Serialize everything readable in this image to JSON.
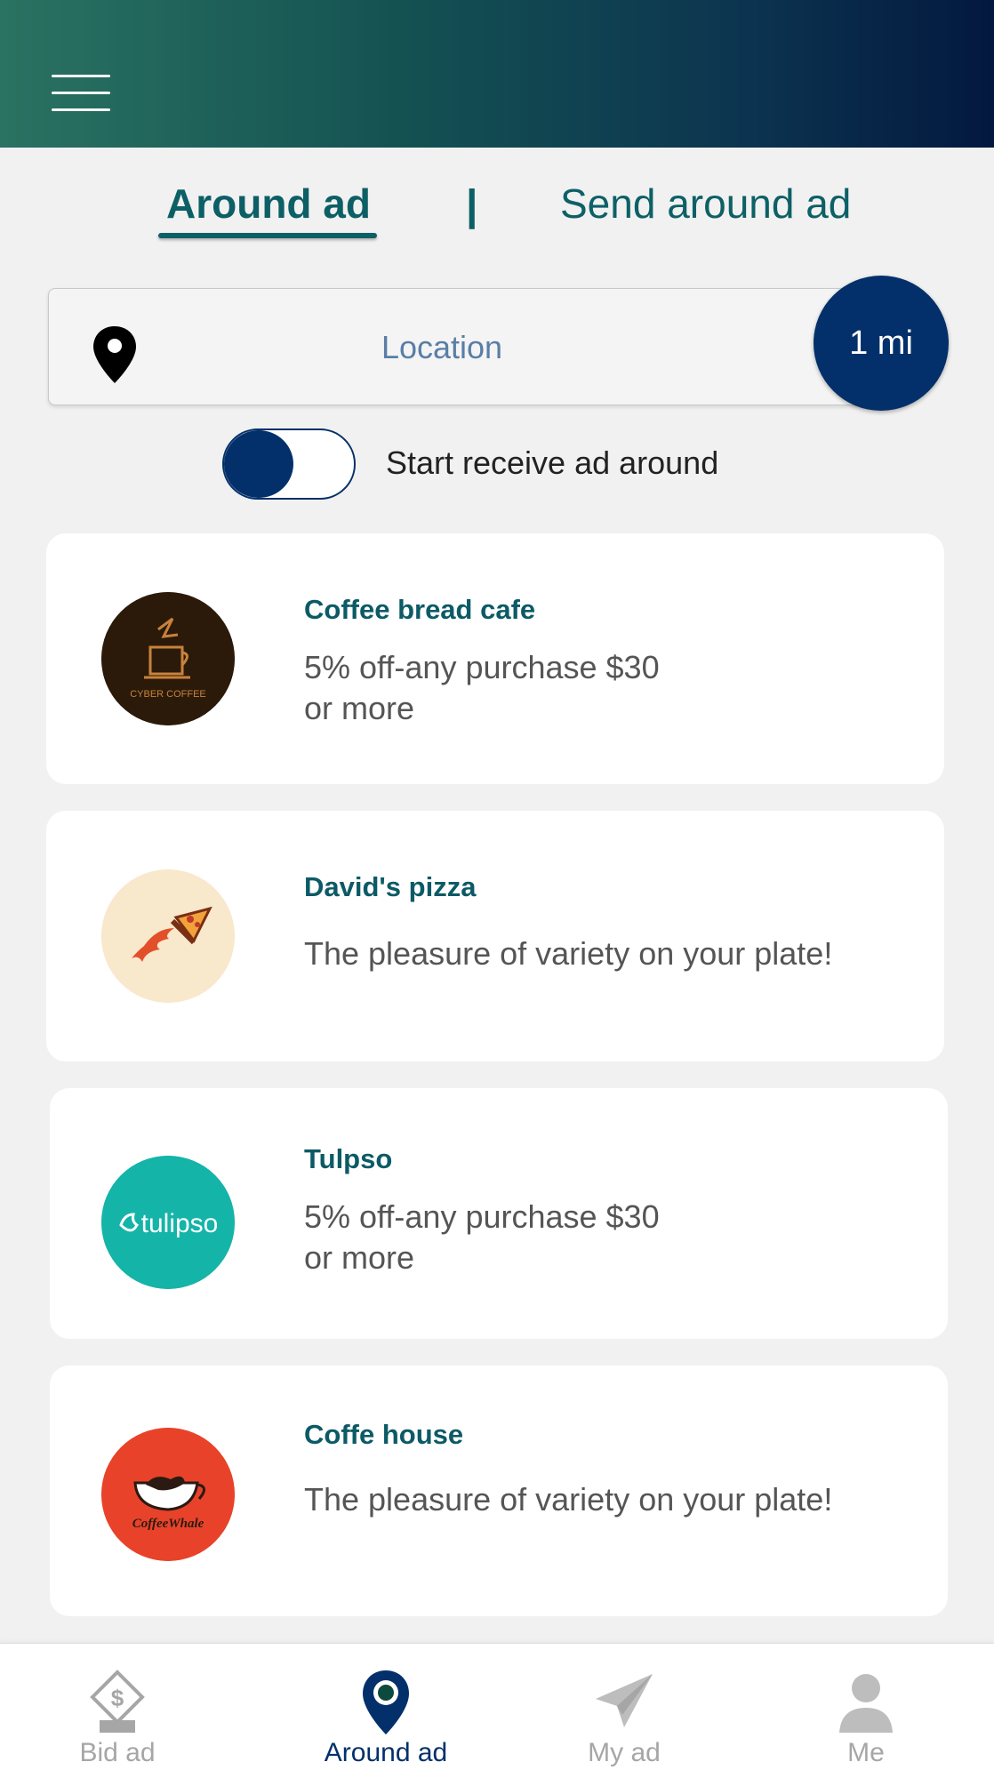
{
  "header": {
    "menu_icon": "hamburger-menu-icon",
    "gradient": [
      "#2a7262",
      "#03183f"
    ]
  },
  "tabs": {
    "active_label": "Around ad",
    "separator": "|",
    "other_label": "Send around ad"
  },
  "location": {
    "placeholder": "Location",
    "pin_icon": "location-pin-icon",
    "radius": "1 mi"
  },
  "receive_toggle": {
    "label": "Start receive ad around",
    "checked": false
  },
  "ads": [
    {
      "title": "Coffee bread cafe",
      "description": "5% off-any purchase $30 or more",
      "logo": "cyber-coffee-logo",
      "logo_text": "CYBER COFFEE"
    },
    {
      "title": "David's pizza",
      "description": "The pleasure of variety on your plate!",
      "logo": "pizza-logo"
    },
    {
      "title": "Tulpso",
      "description": "5% off-any purchase $30 or more",
      "logo": "tulipso-logo",
      "logo_text": "tulipso"
    },
    {
      "title": "Coffe house",
      "description": "The pleasure of variety on your plate!",
      "logo": "coffee-whale-logo",
      "logo_text": "CoffeeWhale"
    }
  ],
  "bottom_nav": [
    {
      "label": "Bid ad",
      "icon": "bid-ad-icon",
      "active": false
    },
    {
      "label": "Around ad",
      "icon": "location-pin-icon",
      "active": true
    },
    {
      "label": "My ad",
      "icon": "paper-plane-icon",
      "active": false
    },
    {
      "label": "Me",
      "icon": "user-icon",
      "active": false
    }
  ],
  "colors": {
    "accent": "#03306a",
    "teal": "#0d5f66",
    "background": "#f1f1f1"
  }
}
